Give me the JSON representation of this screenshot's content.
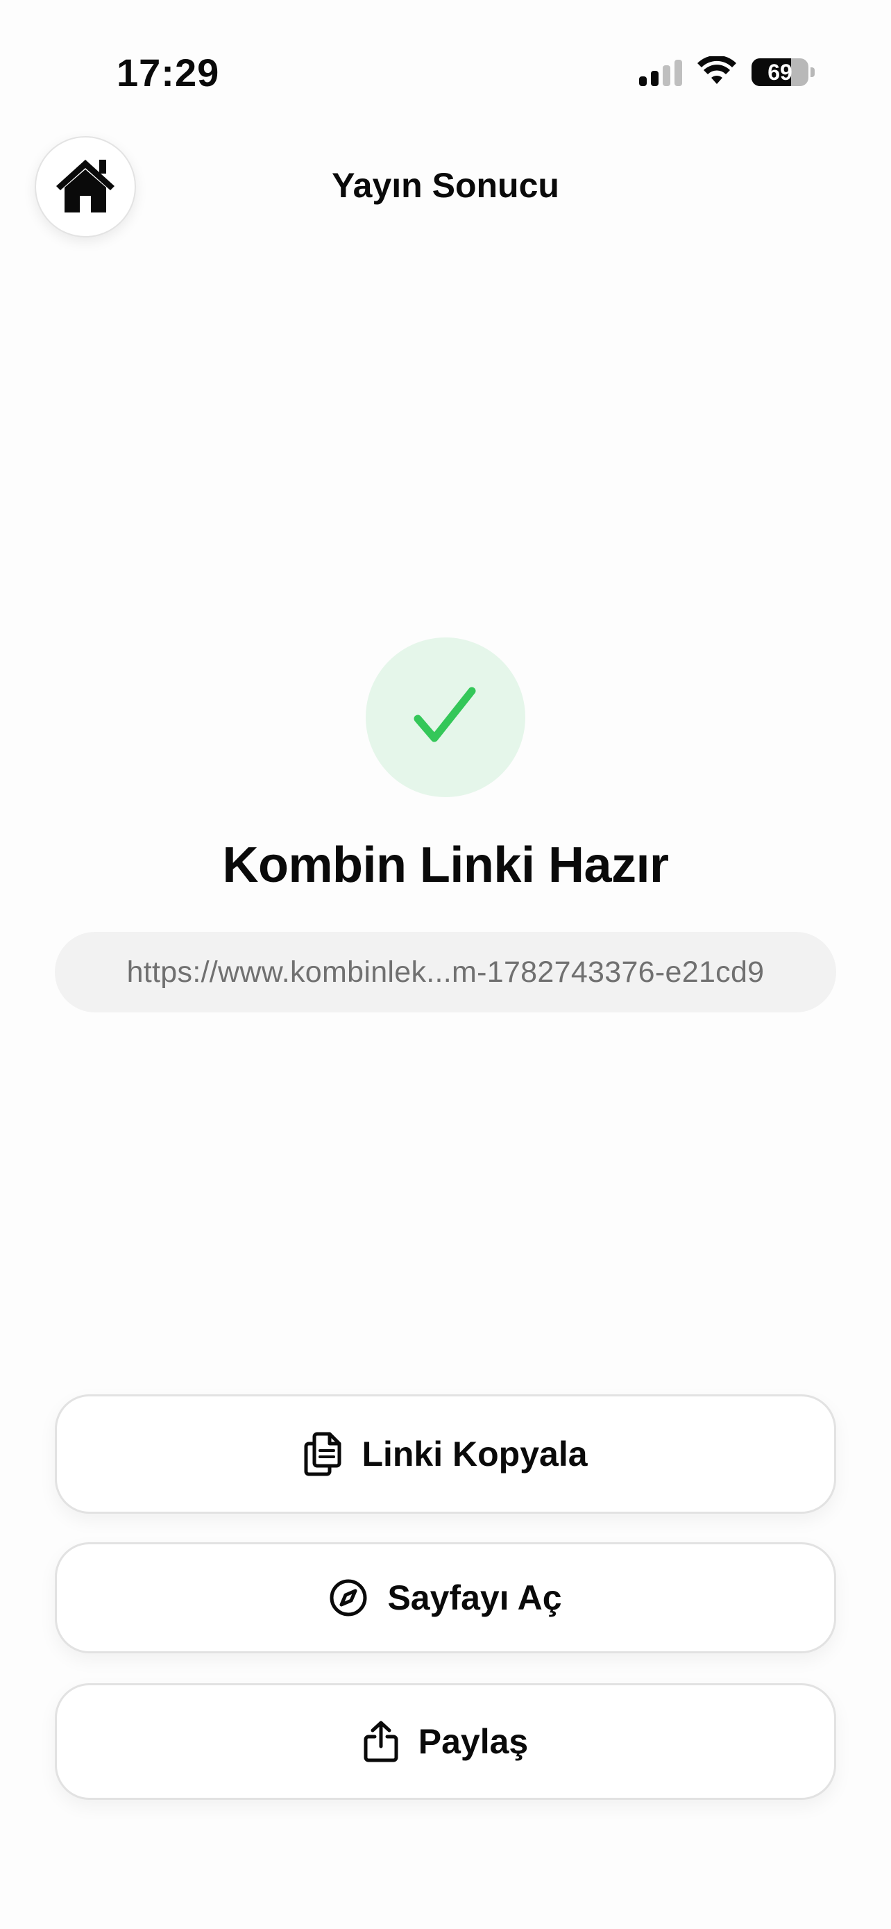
{
  "status_bar": {
    "time": "17:29",
    "battery_level": "69",
    "signal_bars_active": 2,
    "signal_bars_total": 4
  },
  "header": {
    "title": "Yayın Sonucu",
    "home_icon": "house-icon"
  },
  "result": {
    "status_icon": "checkmark-icon",
    "headline": "Kombin Linki Hazır",
    "link": "https://www.kombinlek...m-1782743376-e21cd9"
  },
  "actions": {
    "copy": {
      "label": "Linki Kopyala",
      "icon": "copy-documents-icon"
    },
    "open": {
      "label": "Sayfayı Aç",
      "icon": "compass-icon"
    },
    "share": {
      "label": "Paylaş",
      "icon": "share-icon"
    }
  },
  "colors": {
    "accent_green": "#34c759",
    "success_bg": "#e5f6ea",
    "background": "#fdfdfd",
    "link_field_bg": "#f2f2f2"
  }
}
